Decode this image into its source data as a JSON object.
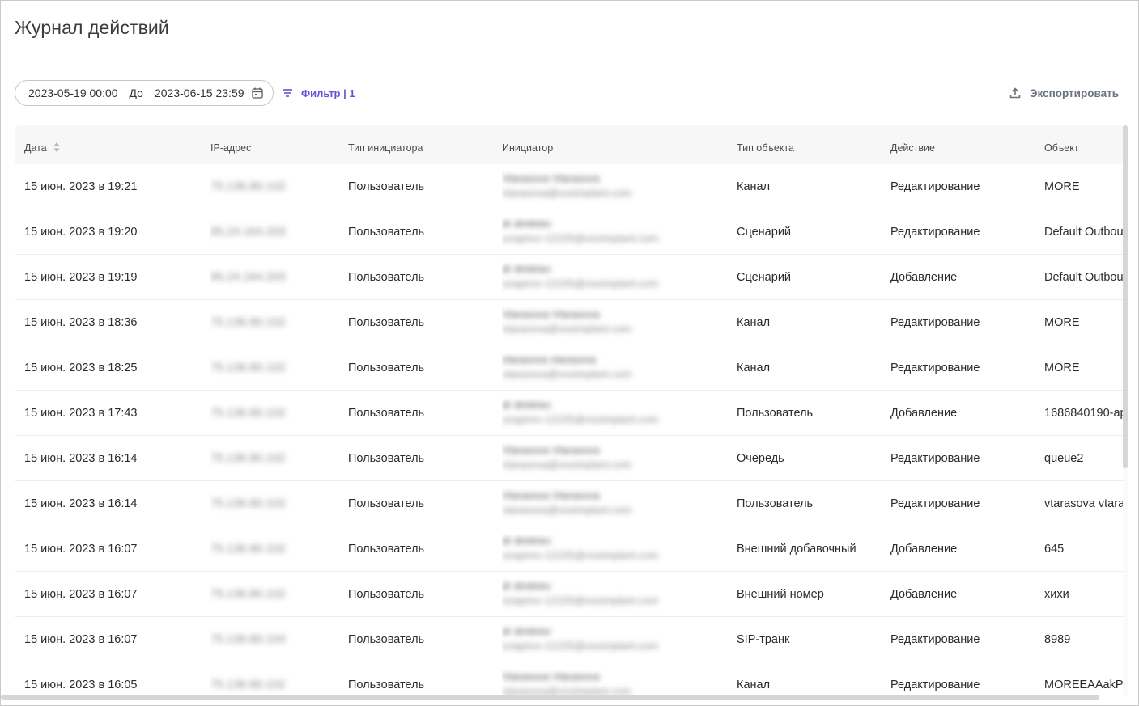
{
  "page": {
    "title": "Журнал действий"
  },
  "toolbar": {
    "date_from": "2023-05-19 00:00",
    "date_separator": "До",
    "date_to": "2023-06-15 23:59",
    "filter_label": "Фильтр | 1",
    "export_label": "Экспортировать"
  },
  "colors": {
    "accent": "#6b4fd6",
    "header_bg": "#f7f7f8",
    "export_text": "#6a7280"
  },
  "icons": {
    "calendar": "calendar-icon",
    "filter": "filter-icon",
    "export": "upload-icon",
    "sort": "sort-icon"
  },
  "table": {
    "columns": [
      "Дата",
      "IP-адрес",
      "Тип инициатора",
      "Инициатор",
      "Тип объекта",
      "Действие",
      "Объект"
    ],
    "rows": [
      {
        "date": "15 июн. 2023 в 19:21",
        "ip": "75.136.80.102",
        "initiator_type": "Пользователь",
        "initiator_name": "Vtarasova Vtarasova",
        "initiator_email": "vtarasova@voximplant.com",
        "object_type": "Канал",
        "action": "Редактирование",
        "object": "MORE"
      },
      {
        "date": "15 июн. 2023 в 19:20",
        "ip": "95.24.164.203",
        "initiator_type": "Пользователь",
        "initiator_name": "dr dmitriev",
        "initiator_email": "ozapirov-12155@voximplant.com",
        "object_type": "Сценарий",
        "action": "Редактирование",
        "object": "Default Outbou"
      },
      {
        "date": "15 июн. 2023 в 19:19",
        "ip": "95.24.164.203",
        "initiator_type": "Пользователь",
        "initiator_name": "dr dmitriev",
        "initiator_email": "ozapirov-12155@voximplant.com",
        "object_type": "Сценарий",
        "action": "Добавление",
        "object": "Default Outbou"
      },
      {
        "date": "15 июн. 2023 в 18:36",
        "ip": "75.136.80.102",
        "initiator_type": "Пользователь",
        "initiator_name": "Vtarasova Vtarasova",
        "initiator_email": "vtarasova@voximplant.com",
        "object_type": "Канал",
        "action": "Редактирование",
        "object": "MORE"
      },
      {
        "date": "15 июн. 2023 в 18:25",
        "ip": "75.136.80.102",
        "initiator_type": "Пользователь",
        "initiator_name": "vtarasova vtarasova",
        "initiator_email": "vtarasova@voximplant.com",
        "object_type": "Канал",
        "action": "Редактирование",
        "object": "MORE"
      },
      {
        "date": "15 июн. 2023 в 17:43",
        "ip": "75.136.80.102",
        "initiator_type": "Пользователь",
        "initiator_name": "dr dmitriev",
        "initiator_email": "ozapirov-12155@voximplant.com",
        "object_type": "Пользователь",
        "action": "Добавление",
        "object": "1686840190-ap"
      },
      {
        "date": "15 июн. 2023 в 16:14",
        "ip": "75.136.80.102",
        "initiator_type": "Пользователь",
        "initiator_name": "Vtarasova Vtarasova",
        "initiator_email": "vtarasova@voximplant.com",
        "object_type": "Очередь",
        "action": "Редактирование",
        "object": "queue2"
      },
      {
        "date": "15 июн. 2023 в 16:14",
        "ip": "75.136.80.102",
        "initiator_type": "Пользователь",
        "initiator_name": "Vtarasova Vtarasova",
        "initiator_email": "vtarasova@voximplant.com",
        "object_type": "Пользователь",
        "action": "Редактирование",
        "object": "vtarasova vtara"
      },
      {
        "date": "15 июн. 2023 в 16:07",
        "ip": "75.136.80.102",
        "initiator_type": "Пользователь",
        "initiator_name": "dr dmitriev",
        "initiator_email": "ozapirov-12155@voximplant.com",
        "object_type": "Внешний добавочный",
        "action": "Добавление",
        "object": "645"
      },
      {
        "date": "15 июн. 2023 в 16:07",
        "ip": "75.136.80.102",
        "initiator_type": "Пользователь",
        "initiator_name": "dr dmitriev",
        "initiator_email": "ozapirov-12155@voximplant.com",
        "object_type": "Внешний номер",
        "action": "Добавление",
        "object": "хихи"
      },
      {
        "date": "15 июн. 2023 в 16:07",
        "ip": "75.136.80.104",
        "initiator_type": "Пользователь",
        "initiator_name": "dr dmitriev",
        "initiator_email": "ozapirov-12155@voximplant.com",
        "object_type": "SIP-транк",
        "action": "Редактирование",
        "object": "8989"
      },
      {
        "date": "15 июн. 2023 в 16:05",
        "ip": "75.136.80.102",
        "initiator_type": "Пользователь",
        "initiator_name": "Vtarasova Vtarasova",
        "initiator_email": "vtarasova@voximplant.com",
        "object_type": "Канал",
        "action": "Редактирование",
        "object": "MOREEAAakPp"
      }
    ]
  }
}
